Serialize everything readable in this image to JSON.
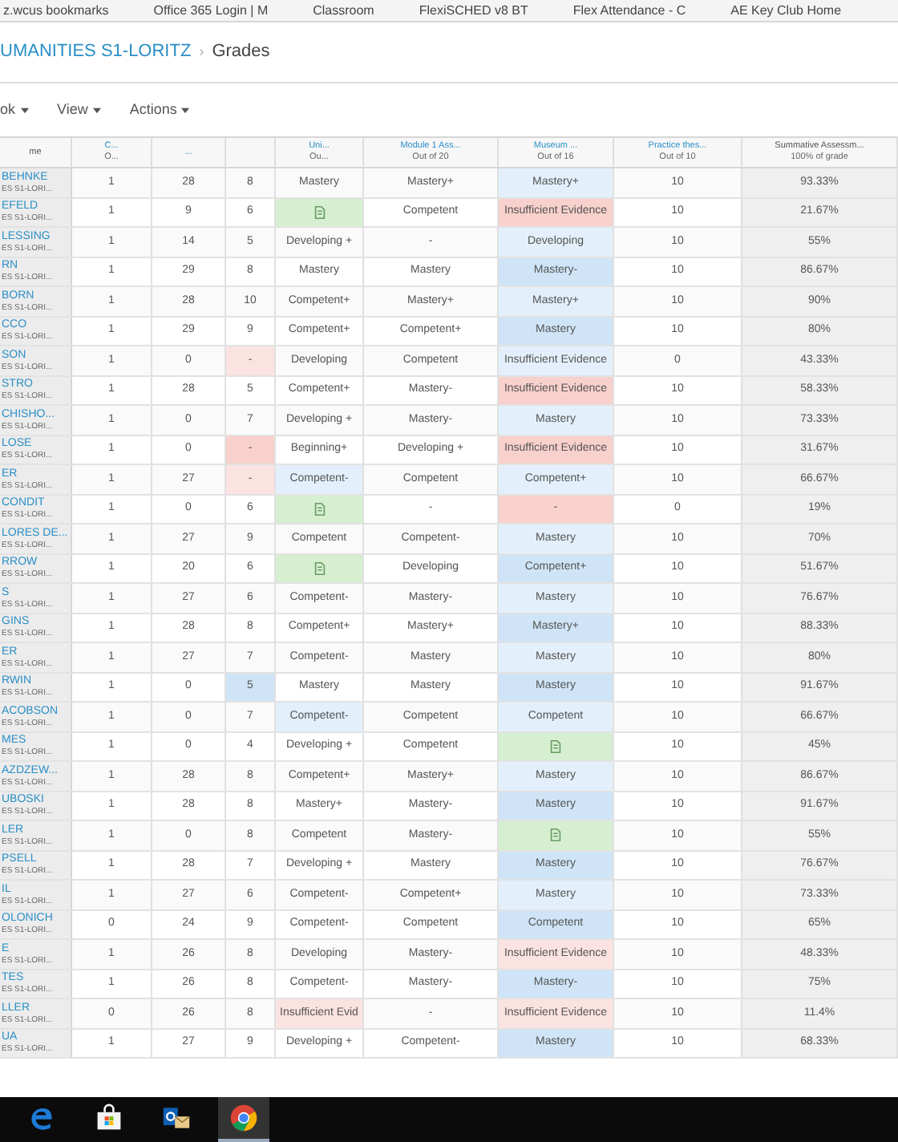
{
  "bookmarks": [
    "z.wcus bookmarks",
    "Office 365 Login | M",
    "Classroom",
    "FlexiSCHED v8 BT",
    "Flex Attendance - C",
    "AE Key Club Home"
  ],
  "breadcrumb": {
    "course": "UMANITIES S1-LORITZ",
    "separator": "›",
    "page": "Grades"
  },
  "toolbar": [
    "ok",
    "View",
    "Actions"
  ],
  "columns": [
    {
      "top": "me"
    },
    {
      "top": "C...",
      "bottom": "O..."
    },
    {
      "top": "..."
    },
    {},
    {
      "top": "Uni...",
      "bottom": "Ou..."
    },
    {
      "top": "Module 1 Ass...",
      "bottom": "Out of 20"
    },
    {
      "top": "Museum ...",
      "bottom": "Out of 16"
    },
    {
      "top": "Practice thes...",
      "bottom": "Out of 10"
    },
    {
      "top": "Summative Assessm...",
      "bottom": "100% of grade"
    }
  ],
  "rows": [
    {
      "name": "BEHNKE",
      "section": "ES S1-LORI...",
      "cells": [
        {
          "text": "1"
        },
        {
          "text": "28"
        },
        {
          "text": "8"
        },
        {
          "text": "Mastery"
        },
        {
          "text": "Mastery+"
        },
        {
          "text": "Mastery+",
          "color": "#e3f0fb"
        },
        {
          "text": "10"
        },
        {
          "text": "93.33%"
        }
      ]
    },
    {
      "name": "EFELD",
      "section": "ES S1-LORI...",
      "cells": [
        {
          "text": "1"
        },
        {
          "text": "9"
        },
        {
          "text": "6"
        },
        {
          "kind": "icon",
          "color": "#d5efd0"
        },
        {
          "text": "Competent"
        },
        {
          "text": "Insufficient Evidence",
          "color": "#f8d0cc"
        },
        {
          "text": "10"
        },
        {
          "text": "21.67%"
        }
      ]
    },
    {
      "name": "LESSING",
      "section": "ES S1-LORI...",
      "cells": [
        {
          "text": "1"
        },
        {
          "text": "14"
        },
        {
          "text": "5"
        },
        {
          "text": "Developing +"
        },
        {
          "text": "-"
        },
        {
          "text": "Developing",
          "color": "#e3f0fb"
        },
        {
          "text": "10"
        },
        {
          "text": "55%"
        }
      ]
    },
    {
      "name": "RN",
      "section": "ES S1-LORI...",
      "cells": [
        {
          "text": "1"
        },
        {
          "text": "29"
        },
        {
          "text": "8"
        },
        {
          "text": "Mastery"
        },
        {
          "text": "Mastery"
        },
        {
          "text": "Mastery-",
          "color": "#cfe5f7"
        },
        {
          "text": "10"
        },
        {
          "text": "86.67%"
        }
      ]
    },
    {
      "name": "BORN",
      "section": "ES S1-LORI...",
      "cells": [
        {
          "text": "1"
        },
        {
          "text": "28"
        },
        {
          "text": "10"
        },
        {
          "text": "Competent+"
        },
        {
          "text": "Mastery+"
        },
        {
          "text": "Mastery+",
          "color": "#e3f0fb"
        },
        {
          "text": "10"
        },
        {
          "text": "90%"
        }
      ]
    },
    {
      "name": "CCO",
      "section": "ES S1-LORI...",
      "cells": [
        {
          "text": "1"
        },
        {
          "text": "29"
        },
        {
          "text": "9"
        },
        {
          "text": "Competent+"
        },
        {
          "text": "Competent+"
        },
        {
          "text": "Mastery",
          "color": "#cfe5f7"
        },
        {
          "text": "10"
        },
        {
          "text": "80%"
        }
      ]
    },
    {
      "name": "SON",
      "section": "ES S1-LORI...",
      "cells": [
        {
          "text": "1"
        },
        {
          "text": "0"
        },
        {
          "text": "-",
          "color": "#fbe3e1"
        },
        {
          "text": "Developing"
        },
        {
          "text": "Competent"
        },
        {
          "text": "Insufficient Evidence",
          "color": "#e3f0fb"
        },
        {
          "text": "0"
        },
        {
          "text": "43.33%"
        }
      ]
    },
    {
      "name": "STRO",
      "section": "ES S1-LORI...",
      "cells": [
        {
          "text": "1"
        },
        {
          "text": "28"
        },
        {
          "text": "5"
        },
        {
          "text": "Competent+"
        },
        {
          "text": "Mastery-"
        },
        {
          "text": "Insufficient Evidence",
          "color": "#f8d0cc"
        },
        {
          "text": "10"
        },
        {
          "text": "58.33%"
        }
      ]
    },
    {
      "name": "CHISHO...",
      "section": "ES S1-LORI...",
      "cells": [
        {
          "text": "1"
        },
        {
          "text": "0"
        },
        {
          "text": "7"
        },
        {
          "text": "Developing +"
        },
        {
          "text": "Mastery-"
        },
        {
          "text": "Mastery",
          "color": "#e3f0fb"
        },
        {
          "text": "10"
        },
        {
          "text": "73.33%"
        }
      ]
    },
    {
      "name": "LOSE",
      "section": "ES S1-LORI...",
      "cells": [
        {
          "text": "1"
        },
        {
          "text": "0"
        },
        {
          "text": "-",
          "color": "#f8d0cc"
        },
        {
          "text": "Beginning+"
        },
        {
          "text": "Developing +"
        },
        {
          "text": "Insufficient Evidence",
          "color": "#f8d0cc"
        },
        {
          "text": "10"
        },
        {
          "text": "31.67%"
        }
      ]
    },
    {
      "name": "ER",
      "section": "ES S1-LORI...",
      "cells": [
        {
          "text": "1"
        },
        {
          "text": "27"
        },
        {
          "text": "-",
          "color": "#fbe3e1"
        },
        {
          "text": "Competent-",
          "color": "#e3f0fb"
        },
        {
          "text": "Competent"
        },
        {
          "text": "Competent+",
          "color": "#e3f0fb"
        },
        {
          "text": "10"
        },
        {
          "text": "66.67%"
        }
      ]
    },
    {
      "name": "CONDIT",
      "section": "ES S1-LORI...",
      "cells": [
        {
          "text": "1"
        },
        {
          "text": "0"
        },
        {
          "text": "6"
        },
        {
          "kind": "icon",
          "color": "#d5efd0"
        },
        {
          "text": "-"
        },
        {
          "text": "-",
          "color": "#f8d0cc"
        },
        {
          "text": "0"
        },
        {
          "text": "19%"
        }
      ]
    },
    {
      "name": "LORES DE...",
      "section": "ES S1-LORI...",
      "cells": [
        {
          "text": "1"
        },
        {
          "text": "27"
        },
        {
          "text": "9"
        },
        {
          "text": "Competent"
        },
        {
          "text": "Competent-"
        },
        {
          "text": "Mastery",
          "color": "#e3f0fb"
        },
        {
          "text": "10"
        },
        {
          "text": "70%"
        }
      ]
    },
    {
      "name": "RROW",
      "section": "ES S1-LORI...",
      "cells": [
        {
          "text": "1"
        },
        {
          "text": "20"
        },
        {
          "text": "6"
        },
        {
          "kind": "icon",
          "color": "#d5efd0"
        },
        {
          "text": "Developing"
        },
        {
          "text": "Competent+",
          "color": "#cfe5f7"
        },
        {
          "text": "10"
        },
        {
          "text": "51.67%"
        }
      ]
    },
    {
      "name": "S",
      "section": "ES S1-LORI...",
      "cells": [
        {
          "text": "1"
        },
        {
          "text": "27"
        },
        {
          "text": "6"
        },
        {
          "text": "Competent-"
        },
        {
          "text": "Mastery-"
        },
        {
          "text": "Mastery",
          "color": "#e3f0fb"
        },
        {
          "text": "10"
        },
        {
          "text": "76.67%"
        }
      ]
    },
    {
      "name": "GINS",
      "section": "ES S1-LORI...",
      "cells": [
        {
          "text": "1"
        },
        {
          "text": "28"
        },
        {
          "text": "8"
        },
        {
          "text": "Competent+"
        },
        {
          "text": "Mastery+"
        },
        {
          "text": "Mastery+",
          "color": "#cfe5f7"
        },
        {
          "text": "10"
        },
        {
          "text": "88.33%"
        }
      ]
    },
    {
      "name": "ER",
      "section": "ES S1-LORI...",
      "cells": [
        {
          "text": "1"
        },
        {
          "text": "27"
        },
        {
          "text": "7"
        },
        {
          "text": "Competent-"
        },
        {
          "text": "Mastery"
        },
        {
          "text": "Mastery",
          "color": "#e3f0fb"
        },
        {
          "text": "10"
        },
        {
          "text": "80%"
        }
      ]
    },
    {
      "name": "RWIN",
      "section": "ES S1-LORI...",
      "cells": [
        {
          "text": "1"
        },
        {
          "text": "0"
        },
        {
          "text": "5",
          "color": "#cfe5f7"
        },
        {
          "text": "Mastery"
        },
        {
          "text": "Mastery"
        },
        {
          "text": "Mastery",
          "color": "#cfe5f7"
        },
        {
          "text": "10"
        },
        {
          "text": "91.67%"
        }
      ]
    },
    {
      "name": "ACOBSON",
      "section": "ES S1-LORI...",
      "cells": [
        {
          "text": "1"
        },
        {
          "text": "0"
        },
        {
          "text": "7"
        },
        {
          "text": "Competent-",
          "color": "#e3f0fb"
        },
        {
          "text": "Competent"
        },
        {
          "text": "Competent",
          "color": "#e3f0fb"
        },
        {
          "text": "10"
        },
        {
          "text": "66.67%"
        }
      ]
    },
    {
      "name": "MES",
      "section": "ES S1-LORI...",
      "cells": [
        {
          "text": "1"
        },
        {
          "text": "0"
        },
        {
          "text": "4"
        },
        {
          "text": "Developing +"
        },
        {
          "text": "Competent"
        },
        {
          "kind": "icon",
          "color": "#d5efd0"
        },
        {
          "text": "10"
        },
        {
          "text": "45%"
        }
      ]
    },
    {
      "name": "AZDZEW...",
      "section": "ES S1-LORI...",
      "cells": [
        {
          "text": "1"
        },
        {
          "text": "28"
        },
        {
          "text": "8"
        },
        {
          "text": "Competent+"
        },
        {
          "text": "Mastery+"
        },
        {
          "text": "Mastery",
          "color": "#e3f0fb"
        },
        {
          "text": "10"
        },
        {
          "text": "86.67%"
        }
      ]
    },
    {
      "name": "UBOSKI",
      "section": "ES S1-LORI...",
      "cells": [
        {
          "text": "1"
        },
        {
          "text": "28"
        },
        {
          "text": "8"
        },
        {
          "text": "Mastery+"
        },
        {
          "text": "Mastery-"
        },
        {
          "text": "Mastery",
          "color": "#cfe5f7"
        },
        {
          "text": "10"
        },
        {
          "text": "91.67%"
        }
      ]
    },
    {
      "name": "LER",
      "section": "ES S1-LORI...",
      "cells": [
        {
          "text": "1"
        },
        {
          "text": "0"
        },
        {
          "text": "8"
        },
        {
          "text": "Competent"
        },
        {
          "text": "Mastery-"
        },
        {
          "kind": "icon",
          "color": "#d5efd0"
        },
        {
          "text": "10"
        },
        {
          "text": "55%"
        }
      ]
    },
    {
      "name": "PSELL",
      "section": "ES S1-LORI...",
      "cells": [
        {
          "text": "1"
        },
        {
          "text": "28"
        },
        {
          "text": "7"
        },
        {
          "text": "Developing +"
        },
        {
          "text": "Mastery"
        },
        {
          "text": "Mastery",
          "color": "#cfe5f7"
        },
        {
          "text": "10"
        },
        {
          "text": "76.67%"
        }
      ]
    },
    {
      "name": "IL",
      "section": "ES S1-LORI...",
      "cells": [
        {
          "text": "1"
        },
        {
          "text": "27"
        },
        {
          "text": "6"
        },
        {
          "text": "Competent-"
        },
        {
          "text": "Competent+"
        },
        {
          "text": "Mastery",
          "color": "#e3f0fb"
        },
        {
          "text": "10"
        },
        {
          "text": "73.33%"
        }
      ]
    },
    {
      "name": "OLONICH",
      "section": "ES S1-LORI...",
      "cells": [
        {
          "text": "0"
        },
        {
          "text": "24"
        },
        {
          "text": "9"
        },
        {
          "text": "Competent-"
        },
        {
          "text": "Competent"
        },
        {
          "text": "Competent",
          "color": "#cfe5f7"
        },
        {
          "text": "10"
        },
        {
          "text": "65%"
        }
      ]
    },
    {
      "name": "E",
      "section": "ES S1-LORI...",
      "cells": [
        {
          "text": "1"
        },
        {
          "text": "26"
        },
        {
          "text": "8"
        },
        {
          "text": "Developing"
        },
        {
          "text": "Mastery-"
        },
        {
          "text": "Insufficient Evidence",
          "color": "#fbe3e1"
        },
        {
          "text": "10"
        },
        {
          "text": "48.33%"
        }
      ]
    },
    {
      "name": "TES",
      "section": "ES S1-LORI...",
      "cells": [
        {
          "text": "1"
        },
        {
          "text": "26"
        },
        {
          "text": "8"
        },
        {
          "text": "Competent-"
        },
        {
          "text": "Mastery-"
        },
        {
          "text": "Mastery-",
          "color": "#cfe5f7"
        },
        {
          "text": "10"
        },
        {
          "text": "75%"
        }
      ]
    },
    {
      "name": "LLER",
      "section": "ES S1-LORI...",
      "cells": [
        {
          "text": "0"
        },
        {
          "text": "26"
        },
        {
          "text": "8"
        },
        {
          "text": "Insufficient Evid",
          "color": "#fbe3e1"
        },
        {
          "text": "-"
        },
        {
          "text": "Insufficient Evidence",
          "color": "#fbe3e1"
        },
        {
          "text": "10"
        },
        {
          "text": "11.4%"
        }
      ]
    },
    {
      "name": "UA",
      "section": "ES S1-LORI...",
      "cells": [
        {
          "text": "1"
        },
        {
          "text": "27"
        },
        {
          "text": "9"
        },
        {
          "text": "Developing +"
        },
        {
          "text": "Competent-"
        },
        {
          "text": "Mastery",
          "color": "#cfe5f7"
        },
        {
          "text": "10"
        },
        {
          "text": "68.33%"
        }
      ]
    }
  ],
  "taskbar": [
    {
      "kind": "edge",
      "selected": false
    },
    {
      "kind": "store",
      "selected": false
    },
    {
      "kind": "mail",
      "selected": false
    },
    {
      "kind": "chrome",
      "selected": true
    }
  ]
}
